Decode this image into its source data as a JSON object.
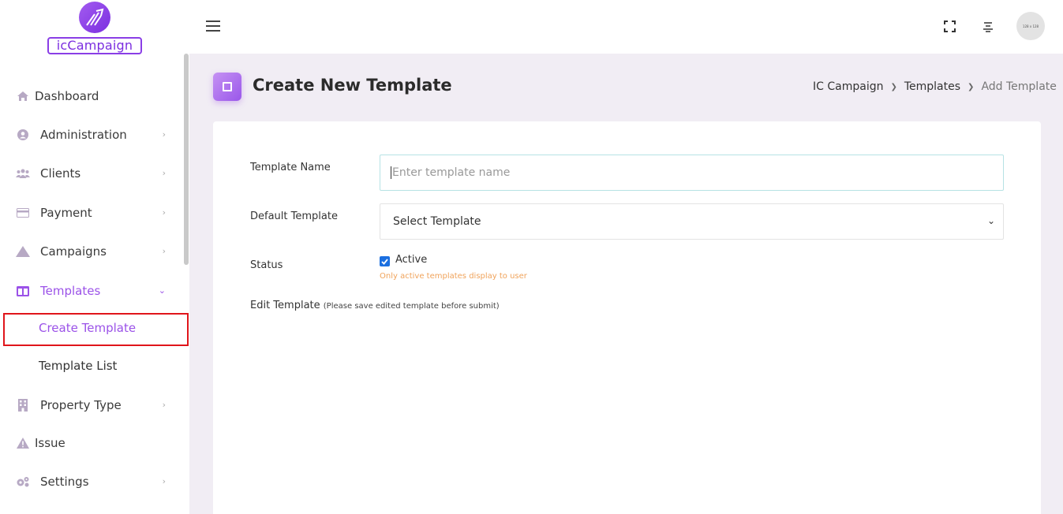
{
  "brand": {
    "logo_text": "icCampaign"
  },
  "sidebar": {
    "items": [
      {
        "label": "Dashboard",
        "icon": "home-icon"
      },
      {
        "label": "Administration",
        "icon": "user-circle-icon"
      },
      {
        "label": "Clients",
        "icon": "users-icon"
      },
      {
        "label": "Payment",
        "icon": "credit-card-icon"
      },
      {
        "label": "Campaigns",
        "icon": "mountain-icon"
      },
      {
        "label": "Templates",
        "icon": "columns-icon"
      },
      {
        "label": "Property Type",
        "icon": "building-icon"
      },
      {
        "label": "Issue",
        "icon": "warning-icon"
      },
      {
        "label": "Settings",
        "icon": "cogs-icon"
      }
    ],
    "sub_items": [
      {
        "label": "Create Template"
      },
      {
        "label": "Template List"
      }
    ]
  },
  "header": {
    "avatar_text": "128 x 128"
  },
  "page": {
    "title": "Create New Template",
    "breadcrumb": [
      "IC Campaign",
      "Templates",
      "Add Template"
    ]
  },
  "form": {
    "template_name_label": "Template Name",
    "template_name_placeholder": "Enter template name",
    "default_template_label": "Default Template",
    "default_template_value": "Select Template",
    "status_label": "Status",
    "active_label": "Active",
    "active_checked": true,
    "active_hint": "Only active templates display to user",
    "edit_template_label": "Edit Template",
    "edit_template_note": "(Please save edited template before submit)"
  },
  "colors": {
    "accent": "#9b52e8",
    "highlight": "#e0151b",
    "hint": "#f0a35b",
    "checkbox": "#1b6fe0"
  }
}
